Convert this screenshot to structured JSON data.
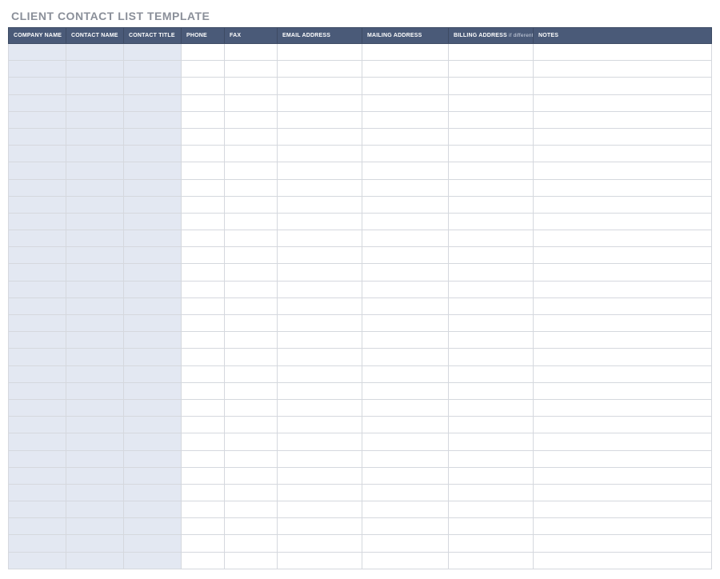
{
  "title": "CLIENT CONTACT LIST TEMPLATE",
  "columns": {
    "company_name": "COMPANY NAME",
    "contact_name": "CONTACT NAME",
    "contact_title": "CONTACT TITLE",
    "phone": "PHONE",
    "fax": "FAX",
    "email_address": "EMAIL ADDRESS",
    "mailing_address": "MAILING ADDRESS",
    "billing_address": "BILLING ADDRESS",
    "billing_address_note": " if different",
    "notes": "NOTES"
  },
  "row_count": 31,
  "shaded_columns": 3,
  "colors": {
    "header_bg": "#4a5a78",
    "shaded_cell": "#e3e8f2",
    "border": "#d5d8de",
    "title_text": "#8a8f99"
  }
}
